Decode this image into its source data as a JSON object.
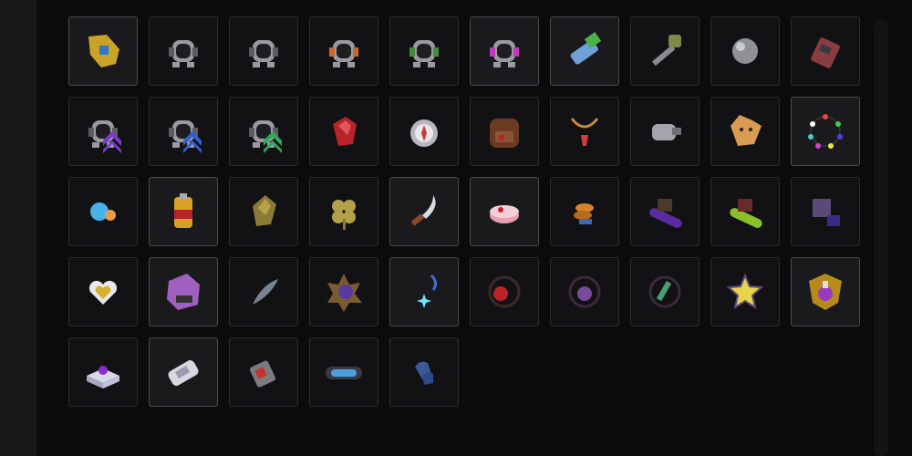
{
  "items": [
    {
      "icon": "golden-gauntlet-icon",
      "highlighted": true
    },
    {
      "icon": "gray-robot-headphones-icon",
      "highlighted": false
    },
    {
      "icon": "gray-robot-headphones-icon",
      "highlighted": false
    },
    {
      "icon": "orange-robot-headphones-icon",
      "highlighted": false
    },
    {
      "icon": "green-robot-headphones-icon",
      "highlighted": false
    },
    {
      "icon": "pink-robot-headphones-icon",
      "highlighted": true
    },
    {
      "icon": "scanner-device-icon",
      "highlighted": true
    },
    {
      "icon": "hammer-tool-icon",
      "highlighted": false
    },
    {
      "icon": "silver-orb-icon",
      "highlighted": false
    },
    {
      "icon": "walkie-talkie-icon",
      "highlighted": false
    },
    {
      "icon": "robot-purple-chevron-icon",
      "highlighted": false
    },
    {
      "icon": "robot-blue-chevron-icon",
      "highlighted": false
    },
    {
      "icon": "robot-green-chevron-icon",
      "highlighted": false
    },
    {
      "icon": "red-gem-icon",
      "highlighted": false
    },
    {
      "icon": "compass-icon",
      "highlighted": false
    },
    {
      "icon": "brown-backpack-icon",
      "highlighted": false
    },
    {
      "icon": "red-pendant-necklace-icon",
      "highlighted": false
    },
    {
      "icon": "gray-claw-icon",
      "highlighted": false
    },
    {
      "icon": "fox-head-icon",
      "highlighted": false
    },
    {
      "icon": "colorful-bead-necklace-icon",
      "highlighted": true
    },
    {
      "icon": "water-drop-creature-icon",
      "highlighted": false
    },
    {
      "icon": "battery-canister-icon",
      "highlighted": true
    },
    {
      "icon": "gold-crystal-icon",
      "highlighted": false
    },
    {
      "icon": "four-leaf-clover-icon",
      "highlighted": false
    },
    {
      "icon": "curved-knife-icon",
      "highlighted": true
    },
    {
      "icon": "pink-cake-icon",
      "highlighted": true
    },
    {
      "icon": "orange-cookie-stack-icon",
      "highlighted": false
    },
    {
      "icon": "purple-skateboard-icon",
      "highlighted": false
    },
    {
      "icon": "green-skateboard-icon",
      "highlighted": false
    },
    {
      "icon": "purple-cube-creature-icon",
      "highlighted": false
    },
    {
      "icon": "heart-locket-icon",
      "highlighted": false
    },
    {
      "icon": "purple-crystal-box-icon",
      "highlighted": true
    },
    {
      "icon": "gray-feather-icon",
      "highlighted": false
    },
    {
      "icon": "purple-spiky-crystal-icon",
      "highlighted": false
    },
    {
      "icon": "blue-sparkle-wand-icon",
      "highlighted": true
    },
    {
      "icon": "red-bead-necklace-icon",
      "highlighted": false
    },
    {
      "icon": "purple-tentacle-necklace-icon",
      "highlighted": false
    },
    {
      "icon": "green-sword-necklace-icon",
      "highlighted": false
    },
    {
      "icon": "yellow-star-icon",
      "highlighted": false
    },
    {
      "icon": "potion-shield-icon",
      "highlighted": true
    },
    {
      "icon": "purple-gem-pedestal-icon",
      "highlighted": false
    },
    {
      "icon": "white-device-icon",
      "highlighted": true
    },
    {
      "icon": "red-tag-icon",
      "highlighted": false
    },
    {
      "icon": "blue-display-panel-icon",
      "highlighted": false
    },
    {
      "icon": "blue-gloves-icon",
      "highlighted": false
    }
  ]
}
